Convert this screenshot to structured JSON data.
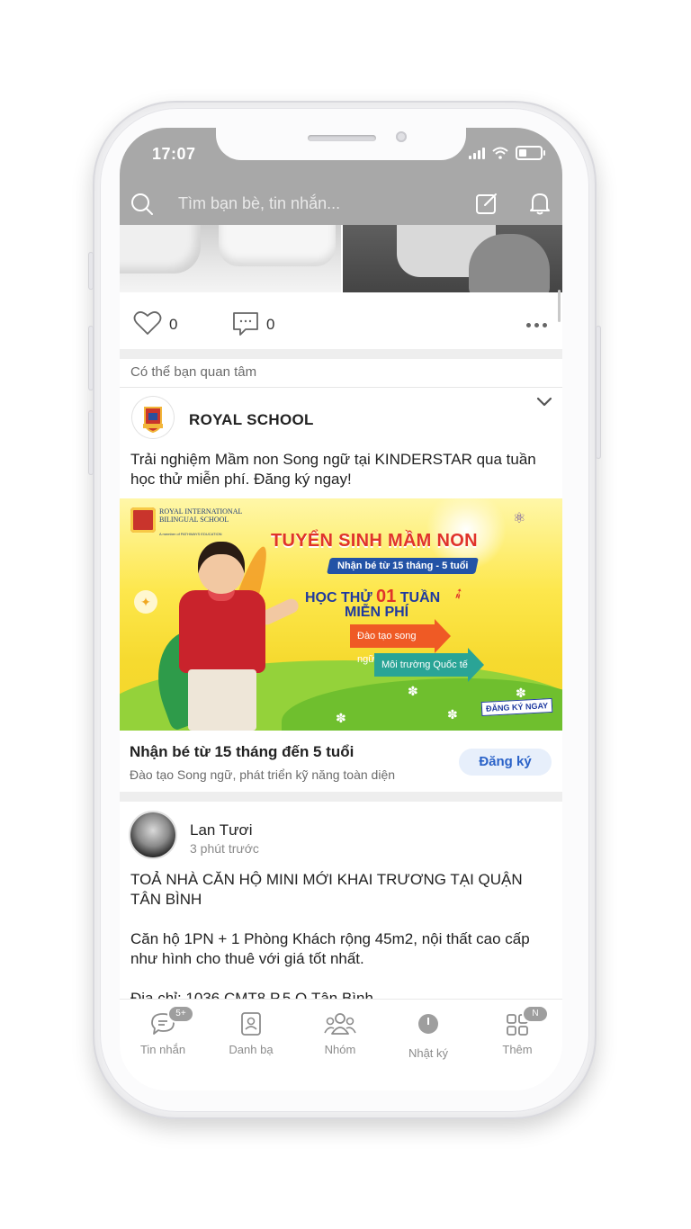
{
  "status_bar": {
    "time": "17:07"
  },
  "search": {
    "placeholder": "Tìm bạn bè, tin nhắn..."
  },
  "post1": {
    "like_count": "0",
    "comment_count": "0"
  },
  "suggestion_label": "Có thể bạn quan tâm",
  "ad": {
    "advertiser": "ROYAL SCHOOL",
    "text": "Trải nghiệm Mầm non Song ngữ tại KINDERSTAR qua tuần học thử miễn phí. Đăng ký ngay!",
    "banner": {
      "school_name": "ROYAL INTERNATIONAL BILINGUAL SCHOOL",
      "school_sub": "A member of PATHWAYS EDUCATION",
      "headline": "TUYỂN SINH MẦM NON",
      "subhead": "Nhận bé từ 15 tháng - 5 tuổi",
      "promo_line1_pre": "HỌC THỬ ",
      "promo_line1_num": "01",
      "promo_line1_post": " TUẦN",
      "promo_line2": "MIỄN PHÍ",
      "arrow1": "Đào tạo song ngữ",
      "arrow2": "Môi trường Quốc tế",
      "cta_tag": "ĐĂNG KÝ NGAY"
    },
    "cta_title": "Nhận bé từ 15 tháng đến 5 tuổi",
    "cta_desc": "Đào tạo Song ngữ, phát triển kỹ năng toàn diện",
    "cta_button": "Đăng ký"
  },
  "post2": {
    "author": "Lan Tươi",
    "time": "3 phút trước",
    "body": "TOẢ NHÀ CĂN HỘ MINI MỚI KHAI TRƯƠNG TẠI QUẬN TÂN BÌNH\n\nCăn hộ 1PN + 1 Phòng Khách rộng 45m2, nội thất cao cấp như hình cho thuê với giá tốt nhất.\n\nĐịa chỉ: 1036 CMT8 P.5 Q.Tân Bình"
  },
  "tabs": [
    {
      "label": "Tin nhắn",
      "badge": "5+",
      "icon": "chat-icon"
    },
    {
      "label": "Danh bạ",
      "icon": "contacts-icon"
    },
    {
      "label": "Nhóm",
      "icon": "group-icon"
    },
    {
      "label": "Nhật ký",
      "icon": "clock-icon"
    },
    {
      "label": "Thêm",
      "badge": "N",
      "icon": "grid-icon"
    }
  ],
  "colors": {
    "topbar": "#a8a8a8",
    "accent": "#2a62c8",
    "button_bg": "#e7effb"
  }
}
